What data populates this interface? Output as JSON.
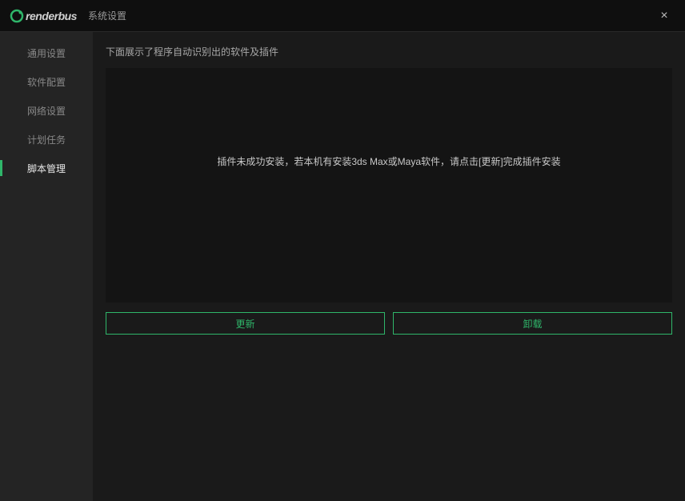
{
  "titlebar": {
    "logo_text": "renderbus",
    "window_title": "系统设置",
    "close_label": "×"
  },
  "sidebar": {
    "items": [
      {
        "label": "通用设置"
      },
      {
        "label": "软件配置"
      },
      {
        "label": "网络设置"
      },
      {
        "label": "计划任务"
      },
      {
        "label": "脚本管理"
      }
    ],
    "active_index": 4
  },
  "main": {
    "description": "下面展示了程序自动识别出的软件及插件",
    "empty_message": "插件未成功安装，若本机有安装3ds Max或Maya软件，请点击[更新]完成插件安装",
    "buttons": {
      "update": "更新",
      "uninstall": "卸载"
    }
  },
  "colors": {
    "accent": "#2fb66a"
  }
}
